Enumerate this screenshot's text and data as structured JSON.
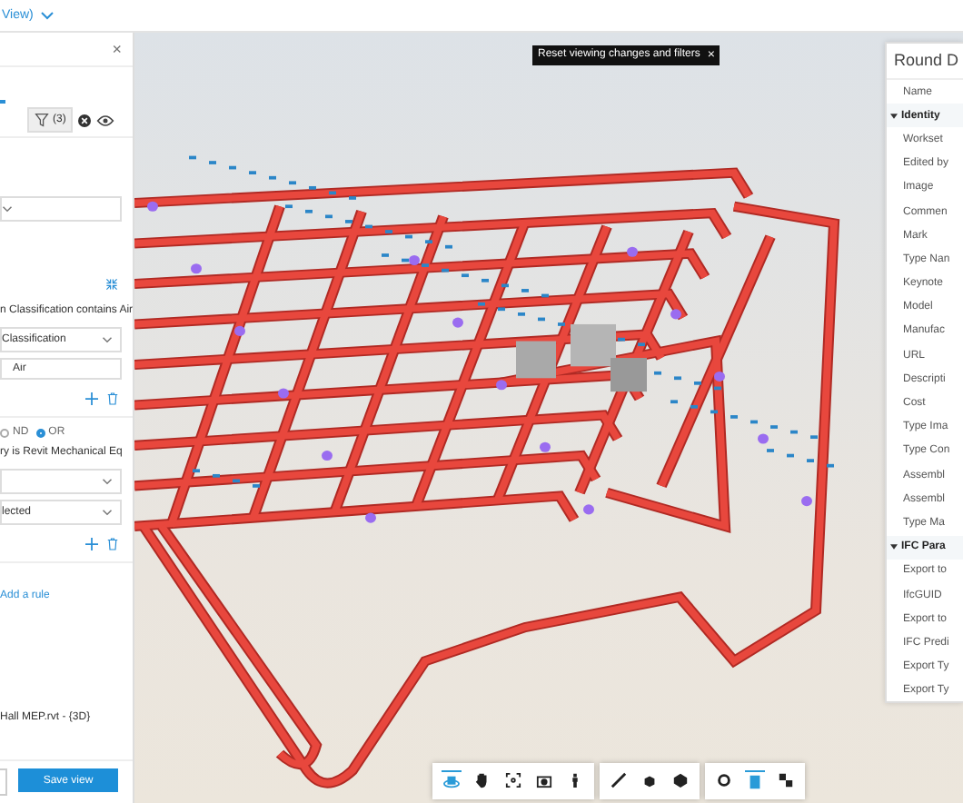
{
  "top_bar": {
    "title": "View)"
  },
  "filter_panel": {
    "close": "×",
    "filter_count": "(3)",
    "rules": [
      {
        "text": "n Classification contains Air",
        "fields": [
          {
            "kind": "select",
            "value": "Classification"
          },
          {
            "kind": "input",
            "value": "Air"
          }
        ]
      },
      {
        "text": "ry is Revit Mechanical Eq",
        "fields": [
          {
            "kind": "select"
          },
          {
            "kind": "select",
            "value": "lected"
          }
        ]
      }
    ],
    "logic": [
      {
        "label": "ND",
        "selected": false
      },
      {
        "label": "OR",
        "selected": true
      }
    ],
    "add_rule": "Add a rule",
    "model_name": "Hall MEP.rvt - {3D}",
    "save_button": "Save view"
  },
  "tooltip": {
    "text": "Reset viewing changes and filters",
    "close": "×"
  },
  "properties": {
    "title": "Round D",
    "rows": [
      {
        "kind": "row",
        "label": "Name"
      },
      {
        "kind": "group",
        "label": "Identity",
        "expanded": true
      },
      {
        "kind": "row",
        "label": "Workset"
      },
      {
        "kind": "row",
        "label": "Edited by"
      },
      {
        "kind": "row",
        "label": "Image"
      },
      {
        "kind": "row",
        "label": "Commen"
      },
      {
        "kind": "row",
        "label": "Mark"
      },
      {
        "kind": "row",
        "label": "Type Nan"
      },
      {
        "kind": "row",
        "label": "Keynote"
      },
      {
        "kind": "row",
        "label": "Model"
      },
      {
        "kind": "row",
        "label": "Manufac"
      },
      {
        "kind": "row",
        "label": "URL"
      },
      {
        "kind": "row",
        "label": "Descripti"
      },
      {
        "kind": "row",
        "label": "Cost"
      },
      {
        "kind": "row",
        "label": "Type Ima"
      },
      {
        "kind": "row",
        "label": "Type Con"
      },
      {
        "kind": "row",
        "label": "Assembl"
      },
      {
        "kind": "row",
        "label": "Assembl"
      },
      {
        "kind": "row",
        "label": "Type Ma"
      },
      {
        "kind": "group",
        "label": "IFC Para",
        "expanded": true
      },
      {
        "kind": "row",
        "label": "Export to"
      },
      {
        "kind": "row",
        "label": "IfcGUID"
      },
      {
        "kind": "row",
        "label": "Export to"
      },
      {
        "kind": "row",
        "label": "IFC Predi"
      },
      {
        "kind": "row",
        "label": "Export Ty"
      },
      {
        "kind": "row",
        "label": "Export Ty"
      }
    ]
  },
  "toolbar": [
    [
      {
        "kind": "orbit",
        "selected": true
      },
      {
        "kind": "pan",
        "selected": false
      },
      {
        "kind": "fit",
        "selected": false
      },
      {
        "kind": "camera",
        "selected": false
      },
      {
        "kind": "walk",
        "selected": false
      }
    ],
    [
      {
        "kind": "measure",
        "selected": false
      },
      {
        "kind": "explode",
        "selected": false
      },
      {
        "kind": "model",
        "selected": false
      }
    ],
    [
      {
        "kind": "settings",
        "selected": false
      },
      {
        "kind": "properties",
        "selected": true
      },
      {
        "kind": "fullscreen",
        "selected": false
      }
    ]
  ]
}
